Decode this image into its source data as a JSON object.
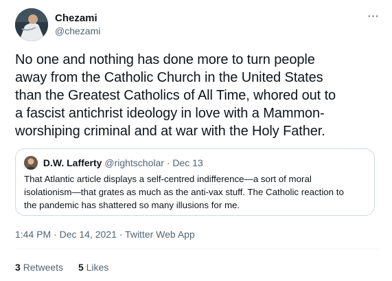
{
  "author": {
    "name": "Chezami",
    "handle": "@chezami"
  },
  "more_icon": "⋯",
  "tweet": {
    "text_lines": [
      "No one and nothing has done more to turn people",
      "away from the Catholic Church in the United States",
      "than the Greatest Catholics of All Time, whored out to",
      "a fascist antichrist ideology in love with a Mammon-",
      "worshiping criminal and at war with the Holy Father."
    ]
  },
  "quoted_tweet": {
    "name": "D.W. Lafferty",
    "meta": "@rightscholar · Dec 13",
    "text_lines": [
      "That Atlantic article displays a self-centred indifference—a sort of moral",
      "isolationism—that grates as much as the anti-vax stuff. The Catholic reaction to",
      "the pandemic has shattered so many illusions for me."
    ]
  },
  "timestamp": "1:44 PM · Dec 14, 2021 · Twitter Web App",
  "stats": {
    "retweets_count": "3",
    "retweets_label": "Retweets",
    "likes_count": "5",
    "likes_label": "Likes"
  }
}
